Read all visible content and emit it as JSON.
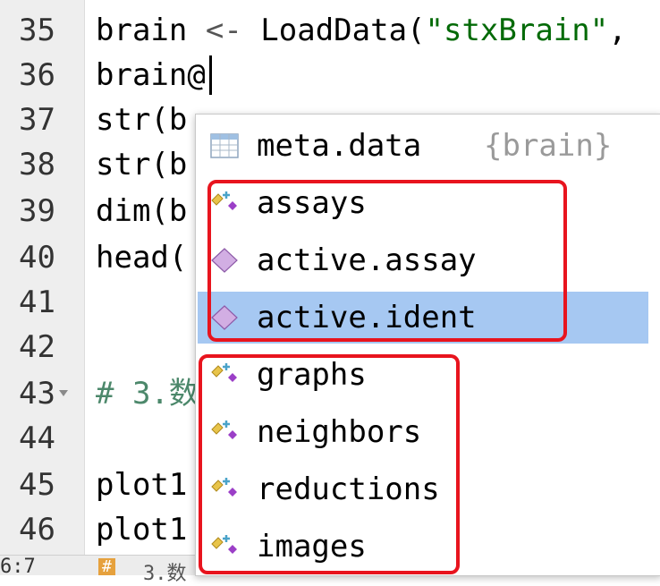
{
  "editor": {
    "lines": [
      {
        "num": "35",
        "code": "brain <- LoadData(\"stxBrain\","
      },
      {
        "num": "36",
        "code": "brain@"
      },
      {
        "num": "37",
        "code": "str(b"
      },
      {
        "num": "38",
        "code": "str(b"
      },
      {
        "num": "39",
        "code": "dim(b"
      },
      {
        "num": "40",
        "code": "head("
      },
      {
        "num": "41",
        "code": ""
      },
      {
        "num": "42",
        "code": ""
      },
      {
        "num": "43",
        "code": "# 3.数"
      },
      {
        "num": "44",
        "code": ""
      },
      {
        "num": "45",
        "code": "plot1"
      },
      {
        "num": "46",
        "code": "plot1"
      }
    ],
    "line35": {
      "ident": "brain",
      "op": "<-",
      "func": "LoadData(",
      "str": "\"stxBrain\"",
      "rest": ","
    },
    "line43": {
      "comment": "# 3.数"
    }
  },
  "status": {
    "position": "6:7",
    "section_badge": "#",
    "section_text": "3.数"
  },
  "autocomplete": {
    "items": [
      {
        "label": "meta.data",
        "source": "{brain}",
        "icon": "table-icon",
        "selected": false
      },
      {
        "label": "assays",
        "source": "",
        "icon": "slot-list-icon",
        "selected": false
      },
      {
        "label": "active.assay",
        "source": "",
        "icon": "slot-diamond-icon",
        "selected": false
      },
      {
        "label": "active.ident",
        "source": "",
        "icon": "slot-diamond-icon",
        "selected": true
      },
      {
        "label": "graphs",
        "source": "",
        "icon": "slot-list-icon",
        "selected": false
      },
      {
        "label": "neighbors",
        "source": "",
        "icon": "slot-list-icon",
        "selected": false
      },
      {
        "label": "reductions",
        "source": "",
        "icon": "slot-list-icon",
        "selected": false
      },
      {
        "label": "images",
        "source": "",
        "icon": "slot-list-icon",
        "selected": false
      }
    ]
  },
  "colors": {
    "highlight_box": "#e8141e",
    "selection": "#a6c8f2",
    "string": "#036a07",
    "comment": "#4c886b"
  }
}
